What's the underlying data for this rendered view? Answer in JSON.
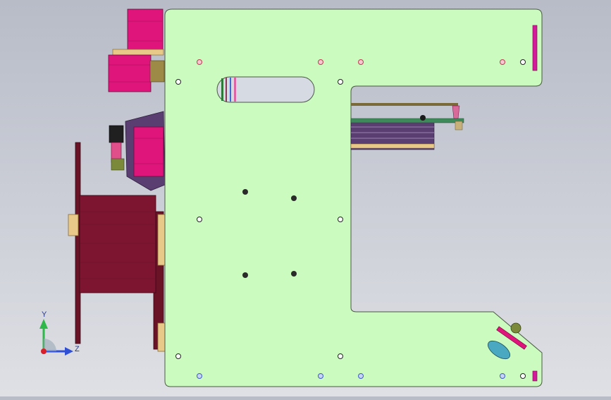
{
  "viewport": {
    "background_top": "#b7bcc7",
    "background_bottom": "#dfe0e5"
  },
  "model": {
    "plate_color": "#ccfbbf",
    "plate_edge_color": "#4a5a44",
    "motor_color": "#e0157c",
    "spool_color": "#7d1530",
    "bracket_color": "#5a3e72",
    "brass_color": "#e9c98a",
    "hole_red": "#c23b54",
    "hole_blue": "#3d5cc9"
  },
  "triad": {
    "y_label": "Y",
    "z_label": "Z",
    "y_color": "#2fb84a",
    "z_color": "#2f4fd4",
    "x_color": "#d81e2a"
  }
}
